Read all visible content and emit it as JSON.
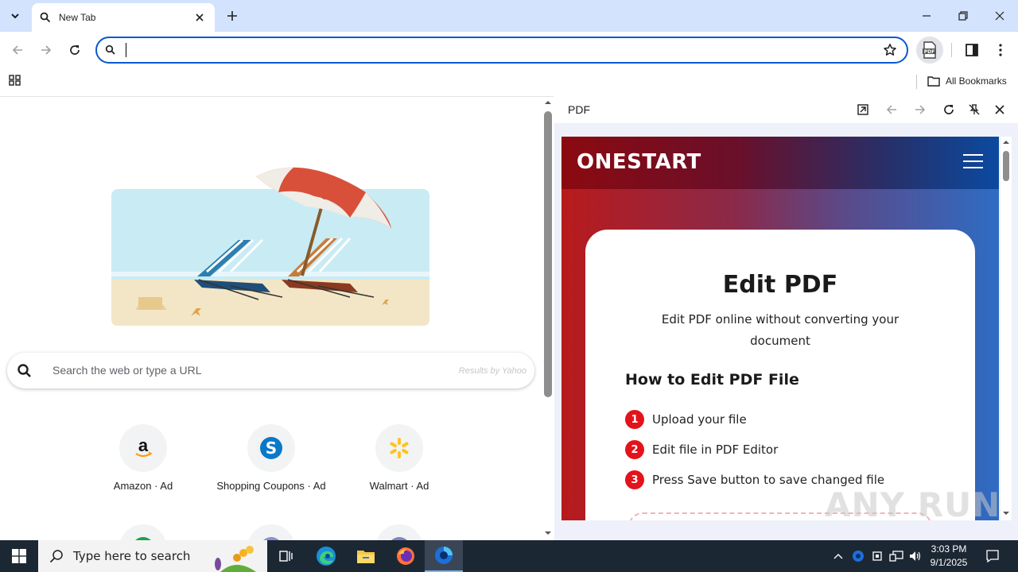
{
  "browser": {
    "tab": {
      "title": "New Tab"
    },
    "window_controls": [
      "minimize",
      "restore",
      "close"
    ],
    "omnibox": {
      "value": "",
      "placeholder": ""
    },
    "extension": {
      "label": "PDF"
    },
    "bookmarks_bar": {
      "all_bookmarks_label": "All Bookmarks"
    }
  },
  "new_tab_page": {
    "search": {
      "placeholder": "Search the web or type a URL",
      "powered_by": "Results by Yahoo"
    },
    "shortcuts": [
      {
        "label": "Amazon · Ad",
        "icon": "amazon-icon"
      },
      {
        "label": "Shopping Coupons · Ad",
        "icon": "shopping-coupons-icon"
      },
      {
        "label": "Walmart · Ad",
        "icon": "walmart-icon"
      }
    ]
  },
  "side_panel": {
    "title": "PDF",
    "site": {
      "logo": "ONESTART",
      "heading": "Edit PDF",
      "subtitle": "Edit PDF online without converting your document",
      "howto_title": "How to Edit PDF File",
      "steps": [
        {
          "num": "1",
          "text": "Upload your file"
        },
        {
          "num": "2",
          "text": "Edit file in PDF Editor"
        },
        {
          "num": "3",
          "text": "Press Save button to save changed file"
        }
      ]
    },
    "watermark": "ANY RUN"
  },
  "taskbar": {
    "search_placeholder": "Type here to search",
    "clock": {
      "time": "3:03 PM",
      "date": "9/1/2025"
    }
  },
  "colors": {
    "accent": "#0b57d0",
    "tabstrip": "#d3e3fd",
    "step_badge": "#e4121a",
    "taskbar": "#1c2734"
  }
}
